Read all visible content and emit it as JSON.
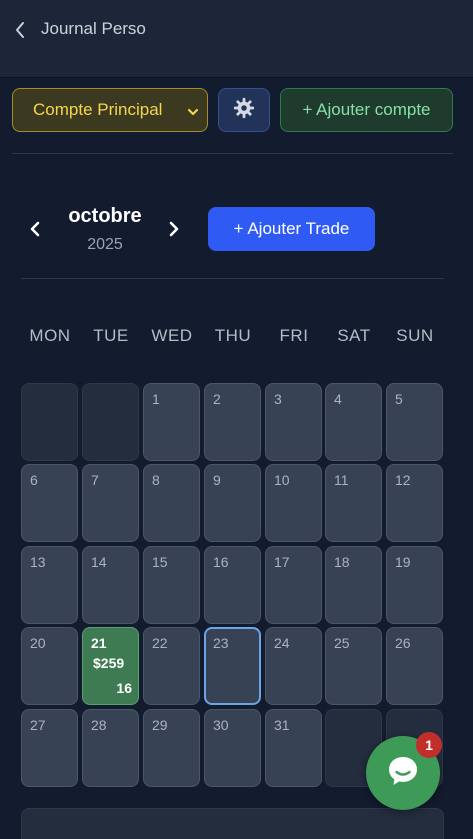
{
  "header": {
    "title": "Journal Perso",
    "back_icon": "chevron-left-icon"
  },
  "toolbar": {
    "account_selected": "Compte Principal",
    "settings_icon": "gear-icon",
    "add_account_label": "+ Ajouter compte"
  },
  "calendar": {
    "month": "octobre",
    "year": "2025",
    "add_trade_label": "+ Ajouter Trade",
    "weekdays": [
      "MON",
      "TUE",
      "WED",
      "THU",
      "FRI",
      "SAT",
      "SUN"
    ],
    "days": [
      "1",
      "2",
      "3",
      "4",
      "5",
      "6",
      "7",
      "8",
      "9",
      "10",
      "11",
      "12",
      "13",
      "14",
      "15",
      "16",
      "17",
      "18",
      "19",
      "20",
      "21",
      "22",
      "23",
      "24",
      "25",
      "26",
      "27",
      "28",
      "29",
      "30",
      "31"
    ],
    "today": "23",
    "trade_day": {
      "day": "21",
      "pnl": "$259",
      "trades": "16"
    }
  },
  "chat": {
    "icon": "chat-bubble-icon",
    "badge": "1"
  },
  "colors": {
    "accent_blue": "#2f5bf4",
    "win_green": "#3e7a52",
    "account_gold": "#f5d54a",
    "add_green": "#86e0a5"
  }
}
